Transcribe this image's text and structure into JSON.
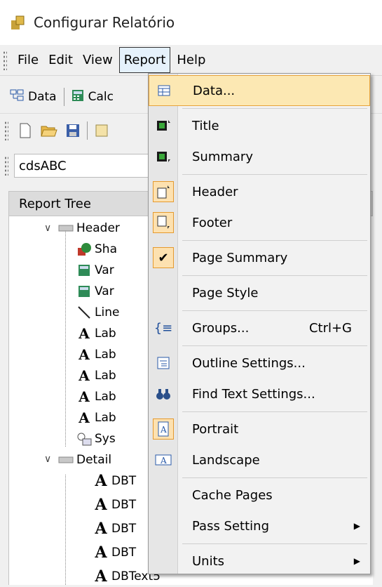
{
  "window": {
    "title": "Configurar Relatório"
  },
  "menubar": {
    "items": [
      "File",
      "Edit",
      "View",
      "Report",
      "Help"
    ],
    "active": "Report"
  },
  "toolbar": {
    "data_label": "Data",
    "calc_label": "Calc"
  },
  "combo": {
    "value": "cdsABC"
  },
  "tree": {
    "header": "Report Tree",
    "nodes": {
      "header_band": "Header",
      "c1": "Sha",
      "c2": "Var",
      "c3": "Var",
      "c4": "Line",
      "c5": "Lab",
      "c6": "Lab",
      "c7": "Lab",
      "c8": "Lab",
      "c9": "Lab",
      "c10": "Sys",
      "detail_band": "Detail",
      "d1": "DBT",
      "d2": "DBT",
      "d3": "DBT",
      "d4": "DBT",
      "d5": "DBText5"
    }
  },
  "report_menu": {
    "data": "Data...",
    "title": "Title",
    "summary": "Summary",
    "header": "Header",
    "footer": "Footer",
    "page_summary": "Page Summary",
    "page_style": "Page Style",
    "groups": "Groups...",
    "groups_shortcut": "Ctrl+G",
    "outline": "Outline Settings...",
    "find_text": "Find Text Settings...",
    "portrait": "Portrait",
    "landscape": "Landscape",
    "cache_pages": "Cache Pages",
    "pass_setting": "Pass Setting",
    "units": "Units"
  },
  "colors": {
    "highlight_bg": "#fce8b3",
    "highlight_border": "#e7a33a",
    "menu_active_bg": "#e5f1fb"
  }
}
